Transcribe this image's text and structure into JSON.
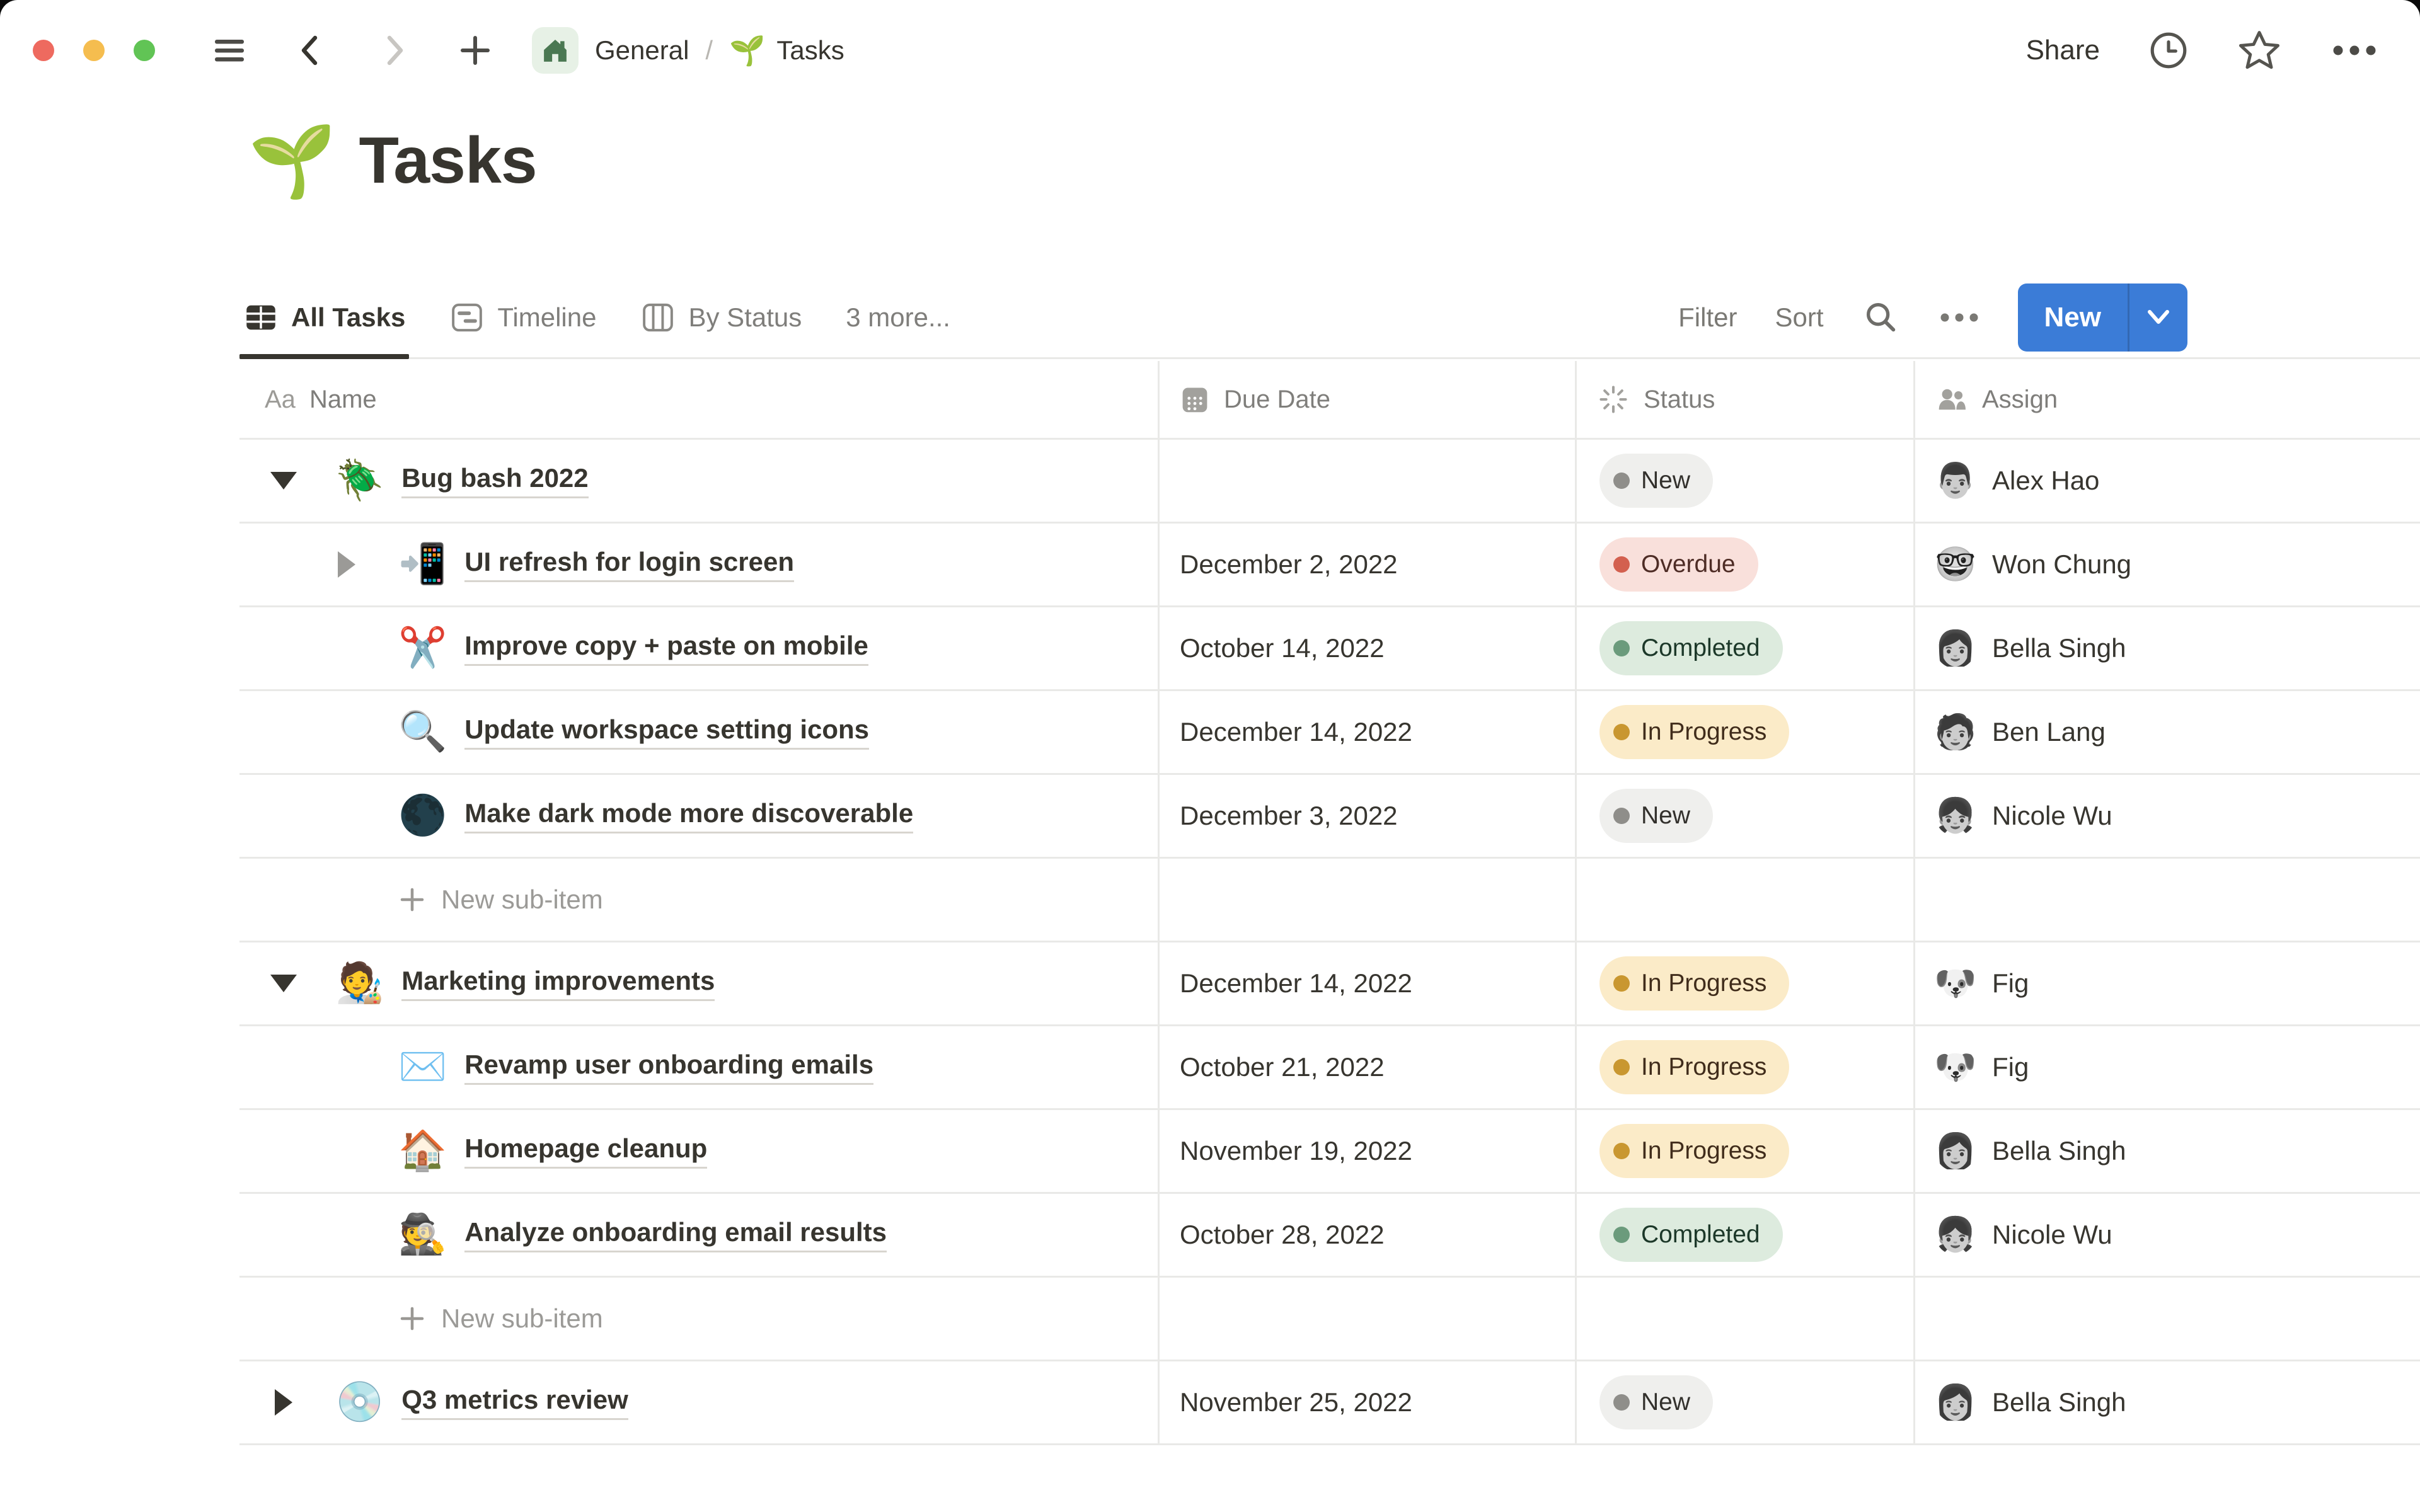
{
  "toolbar": {
    "breadcrumb_space": "General",
    "breadcrumb_separator": "/",
    "breadcrumb_page_emoji": "🌱",
    "breadcrumb_page": "Tasks",
    "share_label": "Share"
  },
  "page": {
    "icon": "🌱",
    "title": "Tasks"
  },
  "tabs": {
    "items": [
      {
        "label": "All Tasks",
        "icon": "table-view-icon",
        "active": true
      },
      {
        "label": "Timeline",
        "icon": "timeline-view-icon",
        "active": false
      },
      {
        "label": "By Status",
        "icon": "board-view-icon",
        "active": false
      },
      {
        "label": "3 more...",
        "icon": null,
        "active": false
      }
    ]
  },
  "view_controls": {
    "filter": "Filter",
    "sort": "Sort",
    "new_label": "New"
  },
  "colors": {
    "accent_blue": "#3B7CD7",
    "text_primary": "#37352F",
    "text_secondary": "#7F7E7B",
    "row_border": "#E9E9E7",
    "traffic_lights": [
      "#EE6A5F",
      "#F5BD4F",
      "#61C455"
    ],
    "status": {
      "new": {
        "bg": "#EFEFED",
        "dot": "#8F8E8A",
        "text": "#32302C"
      },
      "overdue": {
        "bg": "#F9E0DB",
        "dot": "#D3604F",
        "text": "#4E2C25"
      },
      "completed": {
        "bg": "#DDEBDE",
        "dot": "#6B9B7C",
        "text": "#1C3829"
      },
      "in_progress": {
        "bg": "#FBEBC8",
        "dot": "#C99730",
        "text": "#402C1B"
      }
    }
  },
  "table": {
    "columns": [
      {
        "label": "Name",
        "icon": "text-icon",
        "icon_glyph": "Aa"
      },
      {
        "label": "Due Date",
        "icon": "calendar-icon"
      },
      {
        "label": "Status",
        "icon": "status-burst-icon"
      },
      {
        "label": "Assign",
        "icon": "people-icon"
      }
    ],
    "rows": [
      {
        "kind": "task",
        "level": 0,
        "toggle": "expanded",
        "emoji": "🪲",
        "name": "Bug bash 2022",
        "due": "",
        "status_label": "New",
        "status_key": "new",
        "assignee": "Alex Hao",
        "avatar_emoji": "👨"
      },
      {
        "kind": "task",
        "level": 1,
        "toggle": "collapsed",
        "emoji": "📲",
        "name": "UI refresh for login screen",
        "due": "December 2, 2022",
        "status_label": "Overdue",
        "status_key": "overdue",
        "assignee": "Won Chung",
        "avatar_emoji": "🤓"
      },
      {
        "kind": "task",
        "level": 1,
        "toggle": null,
        "emoji": "✂️",
        "name": "Improve copy + paste on mobile",
        "due": "October 14, 2022",
        "status_label": "Completed",
        "status_key": "completed",
        "assignee": "Bella Singh",
        "avatar_emoji": "👩"
      },
      {
        "kind": "task",
        "level": 1,
        "toggle": null,
        "emoji": "🔍",
        "name": "Update workspace setting icons",
        "due": "December 14, 2022",
        "status_label": "In Progress",
        "status_key": "in_progress",
        "assignee": "Ben Lang",
        "avatar_emoji": "🧑"
      },
      {
        "kind": "task",
        "level": 1,
        "toggle": null,
        "emoji": "🌑",
        "name": "Make dark mode more discoverable",
        "due": "December 3, 2022",
        "status_label": "New",
        "status_key": "new",
        "assignee": "Nicole Wu",
        "avatar_emoji": "👧"
      },
      {
        "kind": "new-sub-item",
        "label": "New sub-item"
      },
      {
        "kind": "task",
        "level": 0,
        "toggle": "expanded",
        "emoji": "🧑‍🎨",
        "name": "Marketing improvements",
        "due": "December 14, 2022",
        "status_label": "In Progress",
        "status_key": "in_progress",
        "assignee": "Fig",
        "avatar_emoji": "🐶"
      },
      {
        "kind": "task",
        "level": 1,
        "toggle": null,
        "emoji": "✉️",
        "name": "Revamp user onboarding emails",
        "due": "October 21, 2022",
        "status_label": "In Progress",
        "status_key": "in_progress",
        "assignee": "Fig",
        "avatar_emoji": "🐶"
      },
      {
        "kind": "task",
        "level": 1,
        "toggle": null,
        "emoji": "🏠",
        "name": "Homepage cleanup",
        "due": "November 19, 2022",
        "status_label": "In Progress",
        "status_key": "in_progress",
        "assignee": "Bella Singh",
        "avatar_emoji": "👩"
      },
      {
        "kind": "task",
        "level": 1,
        "toggle": null,
        "emoji": "🕵️",
        "name": "Analyze onboarding email results",
        "due": "October 28, 2022",
        "status_label": "Completed",
        "status_key": "completed",
        "assignee": "Nicole Wu",
        "avatar_emoji": "👧"
      },
      {
        "kind": "new-sub-item",
        "label": "New sub-item"
      },
      {
        "kind": "task",
        "level": 0,
        "toggle": "collapsed",
        "emoji": "💿",
        "name": "Q3 metrics review",
        "due": "November 25, 2022",
        "status_label": "New",
        "status_key": "new",
        "assignee": "Bella Singh",
        "avatar_emoji": "👩"
      }
    ]
  }
}
